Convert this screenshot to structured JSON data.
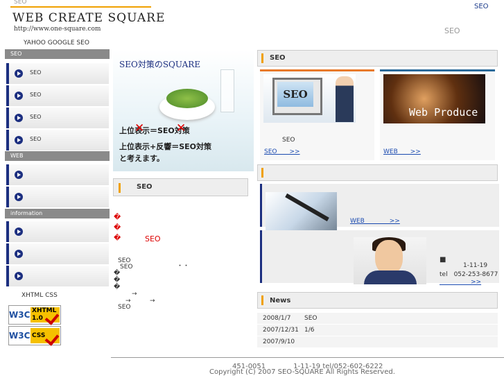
{
  "header": {
    "tiny_seo": "SEO",
    "logo": "Web Create Square",
    "url": "http://www.one-square.com",
    "top_right": "SEO",
    "header_seo": "SEO",
    "tagline": "YAHOO GOOGLE SEO"
  },
  "sidebar": {
    "sections": [
      {
        "title": "SEO",
        "items": [
          "SEO",
          "SEO",
          "SEO",
          "SEO"
        ]
      },
      {
        "title": "WEB",
        "items": [
          "",
          ""
        ]
      },
      {
        "title": "information",
        "items": [
          "",
          "",
          ""
        ]
      }
    ],
    "validators_label": "XHTML CSS",
    "badges": [
      {
        "left": "W3C",
        "right": "XHTML 1.0"
      },
      {
        "left": "W3C",
        "right": "CSS"
      }
    ]
  },
  "center": {
    "image_title": "SEO対策のSQUARE",
    "image_line1": "上位表示＝SEO対策",
    "image_line2": "上位表示+反響＝SEO対策",
    "image_line3": "と考えます。",
    "section_title": "SEO",
    "red_marks": [
      "�",
      "�",
      "�"
    ],
    "red_seo": "SEO",
    "texts": [
      "SEO",
      "SEO",
      "・・",
      "�",
      "�",
      "�",
      "→",
      "→",
      "SEO"
    ]
  },
  "right": {
    "seo_header": "SEO",
    "box1": {
      "image_text": "SEO",
      "caption": "SEO",
      "link": "SEO　　>>"
    },
    "box2": {
      "image_text": "Web Produce",
      "link": "WEB　　>>"
    },
    "box3_link": "WEB　　　　>>",
    "contact": {
      "mark": "■",
      "address": "1-11-19",
      "tel": "tel　052-253-8677",
      "link": "　　　　　>>"
    },
    "news_title": "News",
    "news": [
      {
        "date": "2008/1/7",
        "text": "SEO"
      },
      {
        "date": "2007/12/31",
        "text": "1/6"
      },
      {
        "date": "2007/9/10",
        "text": ""
      }
    ]
  },
  "footer": {
    "line1": "451-0051　　　　1-11-19 tel/052-602-6222",
    "line2": "Copyright (C) 2007 SEO-SQUARE All Rights Reserved."
  },
  "colors": {
    "accent": "#f0a000",
    "nav": "#1c2f80",
    "link": "#1a4ab0",
    "alert": "#dd0000"
  }
}
